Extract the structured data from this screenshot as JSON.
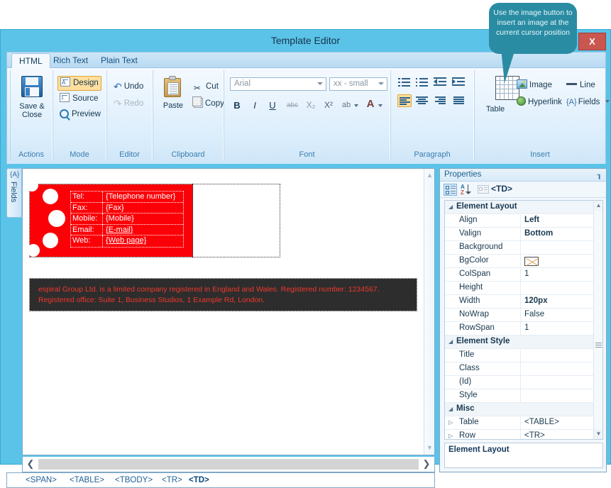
{
  "window": {
    "title": "Template Editor",
    "close_label": "X"
  },
  "callout": {
    "text": "Use the image button to insert an image at the current cursor position",
    "color": "#2a8ca3"
  },
  "ribbon": {
    "tabs": [
      {
        "label": "HTML",
        "active": true
      },
      {
        "label": "Rich Text",
        "active": false
      },
      {
        "label": "Plain Text",
        "active": false
      }
    ],
    "groups": {
      "actions": {
        "label": "Actions",
        "save_close": "Save &\nClose",
        "save_close_line1": "Save &",
        "save_close_line2": "Close"
      },
      "mode": {
        "label": "Mode",
        "design": "Design",
        "source": "Source",
        "preview": "Preview",
        "selected": "Design"
      },
      "editor": {
        "label": "Editor",
        "undo": "Undo",
        "redo": "Redo"
      },
      "clipboard": {
        "label": "Clipboard",
        "paste": "Paste",
        "cut": "Cut",
        "copy": "Copy"
      },
      "font": {
        "label": "Font",
        "family_value": "Arial",
        "size_value": "xx - small",
        "bold": "B",
        "italic": "I",
        "underline": "U",
        "strikethrough": "abc",
        "subscript": "X₂",
        "superscript": "X²",
        "highlight": "ab",
        "fontcolor": "A"
      },
      "paragraph": {
        "label": "Paragraph",
        "numbered_list": "numbered-list",
        "bulleted_list": "bulleted-list",
        "decrease_indent": "decrease-indent",
        "increase_indent": "increase-indent",
        "align_left": "align-left",
        "align_center": "align-center",
        "align_right": "align-right",
        "align_justify": "align-justify",
        "selected": "align-left"
      },
      "insert": {
        "label": "Insert",
        "table": "Table",
        "image": "Image",
        "line": "Line",
        "hyperlink": "Hyperlink",
        "fields": "Fields"
      }
    }
  },
  "left_tab": {
    "label": "Fields",
    "icon": "{A}"
  },
  "editor": {
    "signature": {
      "rows": [
        {
          "key": "Tel:",
          "value": "{Telephone number}",
          "link": false
        },
        {
          "key": "Fax:",
          "value": "{Fax}",
          "link": false
        },
        {
          "key": "Mobile:",
          "value": "{Mobile}",
          "link": false
        },
        {
          "key": "Email:",
          "value": "{E-mail}",
          "link": true
        },
        {
          "key": "Web:",
          "value": "{Web page}",
          "link": true
        }
      ],
      "bg_color": "#fb0007"
    },
    "disclaimer": {
      "text": "espiral Group Ltd. is a limited company registered in England and Wales. Registered number: 1234567. Registered office: Suite 1, Business Studios, 1 Example Rd, London.",
      "bg_color": "#2d2d2d",
      "text_color": "#f1372d"
    }
  },
  "statusbar": {
    "crumbs": [
      {
        "label": "<SPAN>",
        "current": false
      },
      {
        "label": "<TABLE>",
        "current": false
      },
      {
        "label": "<TBODY>",
        "current": false
      },
      {
        "label": "<TR>",
        "current": false
      },
      {
        "label": "<TD>",
        "current": true
      }
    ]
  },
  "properties": {
    "title": "Properties",
    "pin_icon": "┒",
    "target": "<TD>",
    "toolbar": {
      "categorized": "categorized-view-icon",
      "alphabetical": "alphabetical-sort-icon",
      "property_pages": "property-pages-icon"
    },
    "description": "Element Layout",
    "rows": [
      {
        "type": "category",
        "name": "Element Layout",
        "expander": "◢"
      },
      {
        "type": "prop",
        "name": "Align",
        "value": "Left",
        "bold": true
      },
      {
        "type": "prop",
        "name": "Valign",
        "value": "Bottom",
        "bold": true
      },
      {
        "type": "prop",
        "name": "Background",
        "value": ""
      },
      {
        "type": "prop",
        "name": "BgColor",
        "value": "",
        "swatch": true
      },
      {
        "type": "prop",
        "name": "ColSpan",
        "value": "1"
      },
      {
        "type": "prop",
        "name": "Height",
        "value": ""
      },
      {
        "type": "prop",
        "name": "Width",
        "value": "120px",
        "bold": true
      },
      {
        "type": "prop",
        "name": "NoWrap",
        "value": "False"
      },
      {
        "type": "prop",
        "name": "RowSpan",
        "value": "1"
      },
      {
        "type": "category",
        "name": "Element Style",
        "expander": "◢"
      },
      {
        "type": "prop",
        "name": "Title",
        "value": ""
      },
      {
        "type": "prop",
        "name": "Class",
        "value": ""
      },
      {
        "type": "prop",
        "name": "(Id)",
        "value": ""
      },
      {
        "type": "prop",
        "name": "Style",
        "value": ""
      },
      {
        "type": "category",
        "name": "Misc",
        "expander": "◢"
      },
      {
        "type": "prop",
        "name": "Table",
        "value": "<TABLE>",
        "expander": "▷"
      },
      {
        "type": "prop",
        "name": "Row",
        "value": "<TR>",
        "expander": "▷"
      }
    ]
  }
}
